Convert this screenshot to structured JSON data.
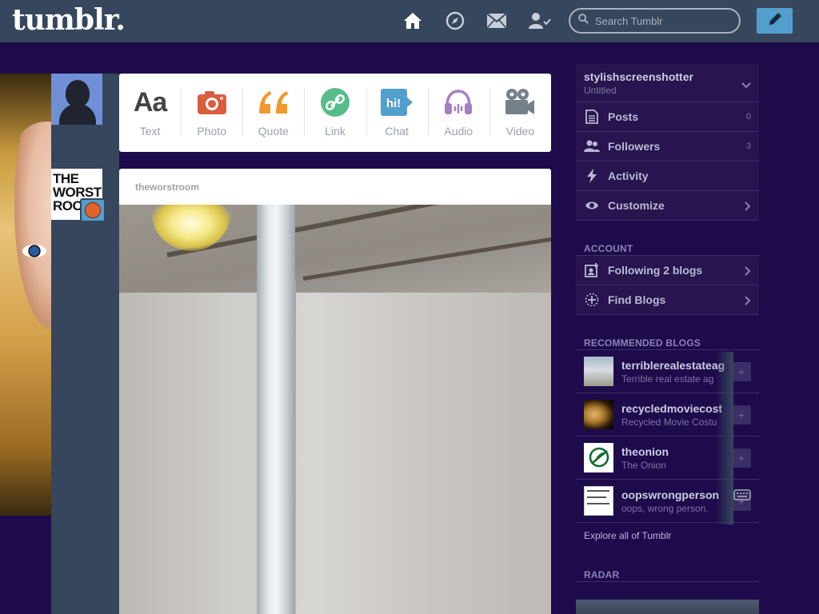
{
  "header": {
    "logo": "tumblr.",
    "search_placeholder": "Search Tumblr",
    "nav_icons": [
      "home-icon",
      "compass-icon",
      "mail-icon",
      "people-icon"
    ],
    "compose_icon": "pencil-icon"
  },
  "colors": {
    "header_bg": "#36465d",
    "page_bg": "#1e0b4b",
    "accent": "#529ecc",
    "text_orange": "#e0652d"
  },
  "post_types": [
    {
      "label": "Text",
      "icon": "text-icon",
      "color": "#444444"
    },
    {
      "label": "Photo",
      "icon": "camera-icon",
      "color": "#d95e40"
    },
    {
      "label": "Quote",
      "icon": "quote-icon",
      "color": "#f2992e"
    },
    {
      "label": "Link",
      "icon": "link-icon",
      "color": "#56bc8a"
    },
    {
      "label": "Chat",
      "icon": "chat-icon",
      "color": "#529ecc"
    },
    {
      "label": "Audio",
      "icon": "headphones-icon",
      "color": "#a77dc2"
    },
    {
      "label": "Video",
      "icon": "video-camera-icon",
      "color": "#748089"
    }
  ],
  "avatars": {
    "blog_avatar_lines": [
      "THE",
      "WORST",
      "ROO"
    ]
  },
  "post": {
    "author": "theworstroom"
  },
  "sidebar": {
    "blog_name": "stylishscreenshotter",
    "blog_subtitle": "Untitled",
    "items": [
      {
        "label": "Posts",
        "count": "0",
        "icon": "document-icon"
      },
      {
        "label": "Followers",
        "count": "3",
        "icon": "people-icon"
      },
      {
        "label": "Activity",
        "count": "",
        "icon": "lightning-icon"
      },
      {
        "label": "Customize",
        "count": "",
        "icon": "eye-icon"
      }
    ],
    "account_heading": "ACCOUNT",
    "account_items": [
      {
        "label": "Following 2 blogs",
        "icon": "add-person-icon"
      },
      {
        "label": "Find Blogs",
        "icon": "sparkle-icon"
      }
    ],
    "recommended_heading": "RECOMMENDED BLOGS",
    "recommended": [
      {
        "name": "terriblerealestateag",
        "desc": "Terrible real estate ag"
      },
      {
        "name": "recycledmoviecost",
        "desc": "Recycled Movie Costu"
      },
      {
        "name": "theonion",
        "desc": "The Onion"
      },
      {
        "name": "oopswrongperson",
        "desc": "oops, wrong person."
      }
    ],
    "explore": "Explore all of Tumblr",
    "radar_heading": "RADAR"
  }
}
